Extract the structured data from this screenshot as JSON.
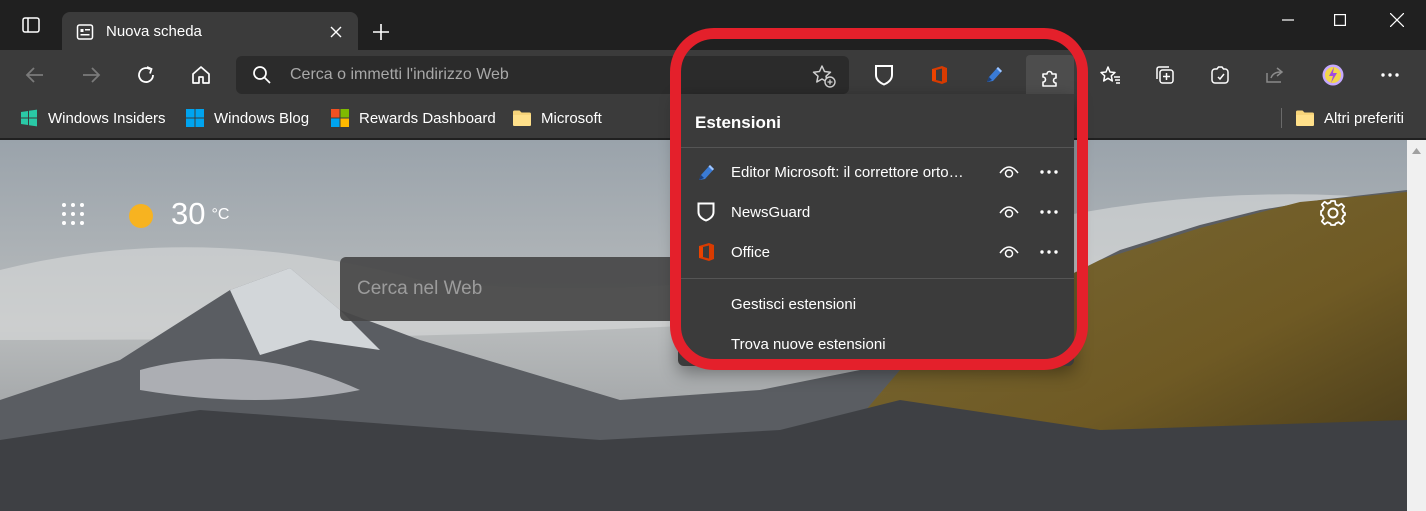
{
  "tab": {
    "title": "Nuova scheda"
  },
  "address_bar": {
    "placeholder": "Cerca o immetti l'indirizzo Web"
  },
  "favorites": [
    {
      "label": "Windows Insiders",
      "icon": "windows-insiders-icon"
    },
    {
      "label": "Windows Blog",
      "icon": "windows-logo-icon"
    },
    {
      "label": "Rewards Dashboard",
      "icon": "microsoft-logo-icon"
    },
    {
      "label": "Microsoft",
      "icon": "folder-icon"
    }
  ],
  "other_favorites": "Altri preferiti",
  "weather": {
    "temp": "30",
    "unit": "°C"
  },
  "page_search": {
    "placeholder": "Cerca nel Web"
  },
  "extensions_menu": {
    "title": "Estensioni",
    "items": [
      {
        "name": "Editor Microsoft: il correttore orto…",
        "icon": "editor-pen-icon"
      },
      {
        "name": "NewsGuard",
        "icon": "newsguard-shield-icon"
      },
      {
        "name": "Office",
        "icon": "office-logo-icon"
      }
    ],
    "actions": [
      "Gestisci estensioni",
      "Trova nuove estensioni"
    ]
  },
  "colors": {
    "highlight": "#e4202b",
    "toolbar": "#3b3b3b",
    "tabstrip": "#202020"
  }
}
